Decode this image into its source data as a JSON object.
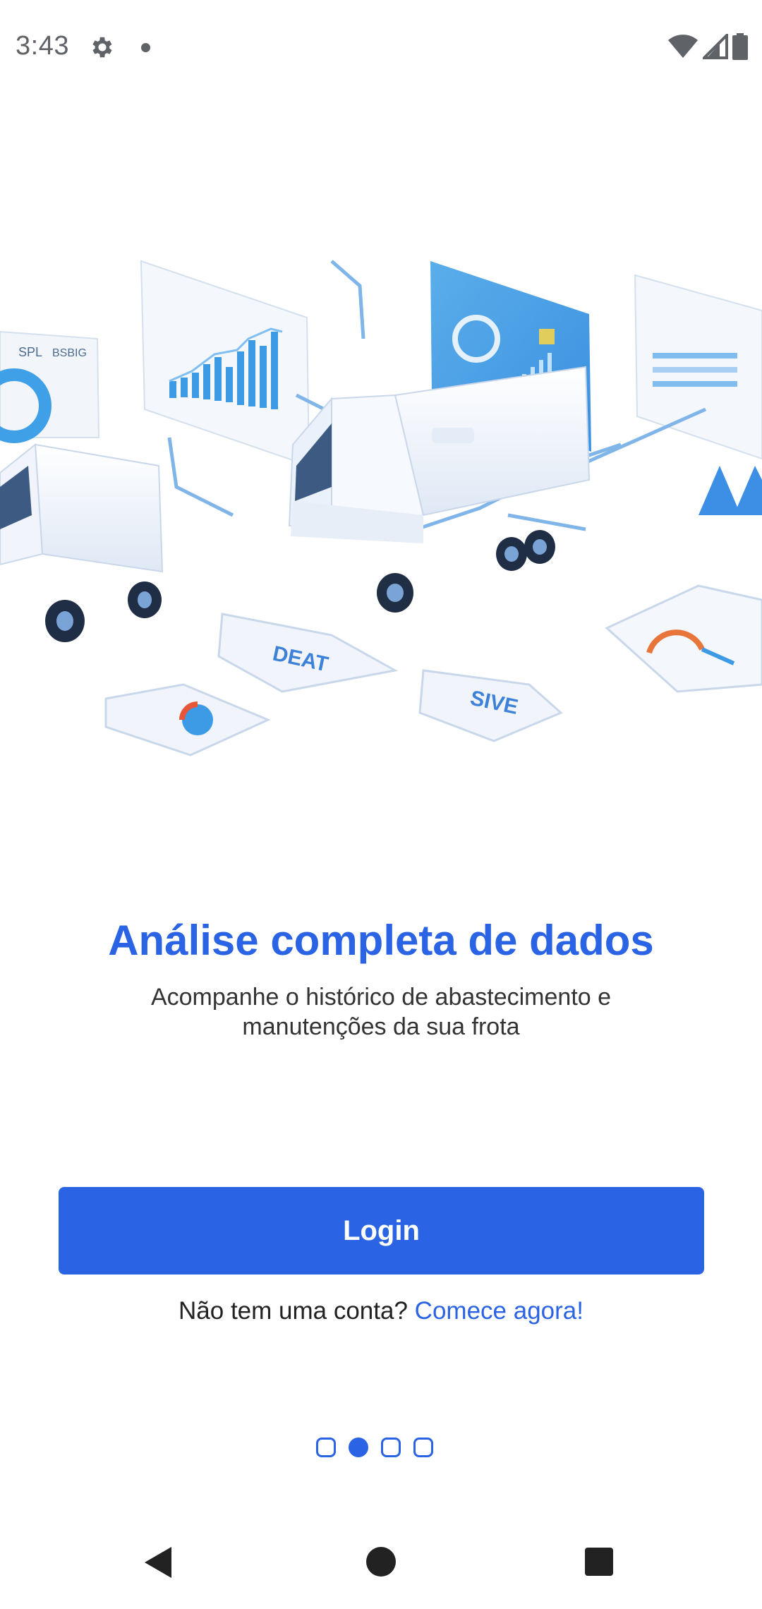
{
  "status_bar": {
    "time": "3:43",
    "icons": [
      "gear-icon",
      "notification-dot-icon",
      "wifi-icon",
      "cell-signal-icon",
      "battery-icon"
    ]
  },
  "hero": {
    "icon": "fleet-analytics-illustration",
    "labels": {
      "card_left": "SPL",
      "card_left_b": "BSBIG",
      "pad_left": "DEAT",
      "pad_right": "SIVE"
    }
  },
  "onboarding": {
    "title": "Análise completa de dados",
    "subtitle": "Acompanhe o histórico de abastecimento e manutenções da sua frota"
  },
  "actions": {
    "login_label": "Login",
    "signup_prompt": "Não tem uma conta?",
    "signup_link": "Comece agora!"
  },
  "pager": {
    "total": 4,
    "active_index": 1
  },
  "nav_bar": {
    "icons": [
      "back-icon",
      "home-icon",
      "recents-icon"
    ]
  },
  "colors": {
    "accent": "#2a63e3",
    "text": "#333333",
    "status": "#5f6368"
  }
}
